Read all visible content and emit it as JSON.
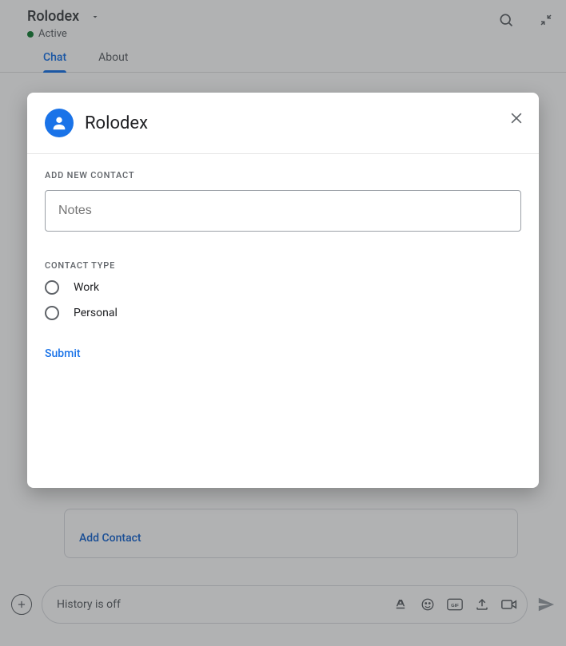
{
  "header": {
    "title": "Rolodex",
    "status": "Active"
  },
  "tabs": [
    {
      "label": "Chat",
      "active": true
    },
    {
      "label": "About",
      "active": false
    }
  ],
  "card": {
    "link": "Add Contact"
  },
  "compose": {
    "placeholder": "History is off"
  },
  "dialog": {
    "title": "Rolodex",
    "section1": "ADD NEW CONTACT",
    "notes_placeholder": "Notes",
    "section2": "CONTACT TYPE",
    "options": [
      {
        "label": "Work"
      },
      {
        "label": "Personal"
      }
    ],
    "submit": "Submit"
  }
}
